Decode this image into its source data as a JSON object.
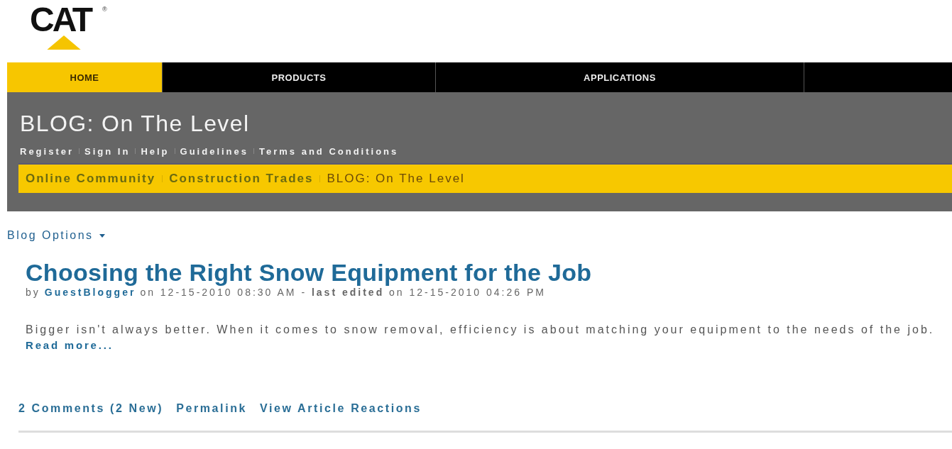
{
  "logo": {
    "text": "CAT",
    "mark": "®"
  },
  "nav": [
    {
      "label": "HOME",
      "selected": true
    },
    {
      "label": "PRODUCTS",
      "selected": false
    },
    {
      "label": "APPLICATIONS",
      "selected": false
    }
  ],
  "header": {
    "title": "BLOG: On The Level",
    "links": [
      "Register",
      "Sign In",
      "Help",
      "Guidelines",
      "Terms and Conditions"
    ],
    "breadcrumb": [
      {
        "label": "Online Community",
        "selected": false
      },
      {
        "label": "Construction Trades",
        "selected": false
      },
      {
        "label": "BLOG: On The Level",
        "selected": true
      }
    ]
  },
  "blog_options": "Blog Options",
  "post": {
    "title": "Choosing the Right Snow Equipment for the Job",
    "byline_prefix": "by",
    "author": "GuestBlogger",
    "byline_rest": "on 12-15-2010 08:30 AM - **last edited** on 12-15-2010 04:26 PM",
    "excerpt": "Bigger isn't always better. When it comes to snow removal, efficiency is about matching your equipment to the needs of the job.",
    "read_more": "Read more...",
    "actions": [
      "2 Comments (2 New)",
      "Permalink",
      "View Article Reactions"
    ]
  }
}
